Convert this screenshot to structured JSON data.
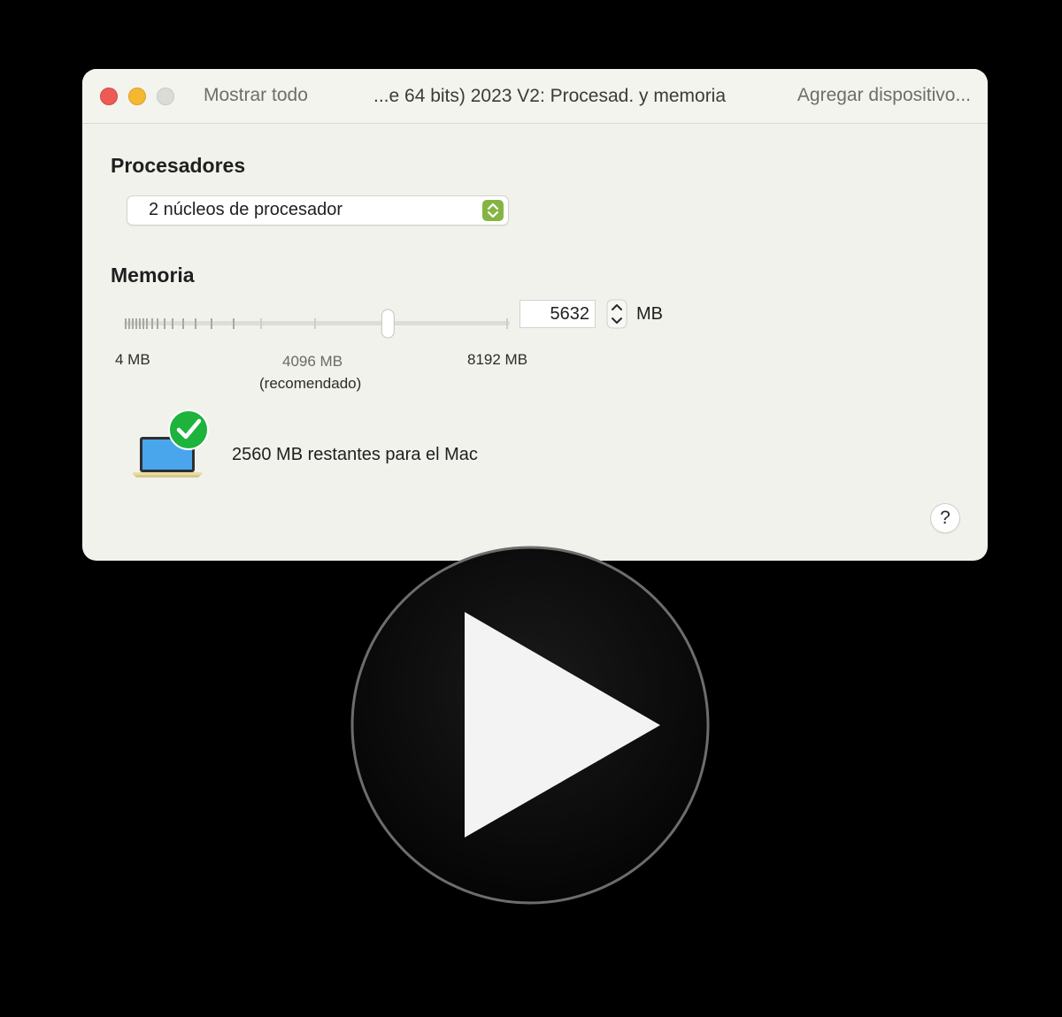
{
  "titlebar": {
    "show_all": "Mostrar todo",
    "title": "...e 64 bits) 2023 V2: Procesad. y memoria",
    "add_device": "Agregar dispositivo..."
  },
  "processors": {
    "heading": "Procesadores",
    "selected": "2 núcleos de procesador"
  },
  "memory": {
    "heading": "Memoria",
    "value": "5632",
    "unit": "MB",
    "slider_fraction": 0.6875,
    "min_label": "4 MB",
    "recommended_label": "4096 MB",
    "recommended_note": "(recomendado)",
    "max_label": "8192 MB"
  },
  "status": {
    "text": "2560 MB restantes para el Mac"
  },
  "help": {
    "label": "?"
  },
  "colors": {
    "window_bg": "#f1f2ec",
    "close": "#ee5b56",
    "minimize": "#f6b731",
    "stepper_accent": "#84b542",
    "check_green": "#1db33c"
  },
  "icons": {
    "mac": "laptop-check-icon",
    "play": "play-icon"
  }
}
